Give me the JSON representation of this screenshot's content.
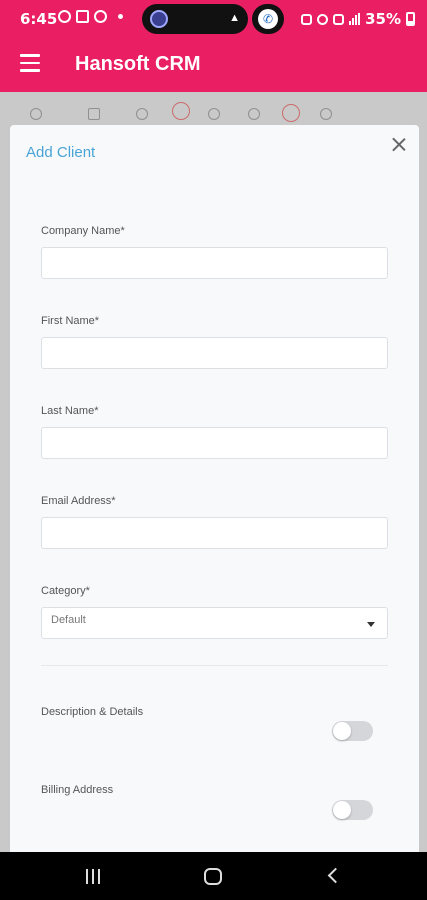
{
  "status_bar": {
    "time": "6:45",
    "battery": "35%",
    "icons": [
      "whatsapp-icon",
      "gallery-icon",
      "chrome-icon",
      "notification-dot-icon",
      "assistant-icon",
      "bell-icon",
      "call-icon",
      "vibrate-icon",
      "alarm-icon",
      "volte-icon",
      "signal-icon",
      "battery-icon"
    ]
  },
  "app_bar": {
    "title": "Hansoft CRM",
    "background": "#e91e63"
  },
  "modal": {
    "title": "Add Client",
    "title_color": "#4aa3d6",
    "fields": {
      "company_name": {
        "label": "Company Name*",
        "value": ""
      },
      "first_name": {
        "label": "First Name*",
        "value": ""
      },
      "last_name": {
        "label": "Last Name*",
        "value": ""
      },
      "email": {
        "label": "Email Address*",
        "value": ""
      },
      "category": {
        "label": "Category*",
        "value": "Default"
      }
    },
    "toggles": {
      "description": {
        "label": "Description & Details",
        "on": false
      },
      "billing": {
        "label": "Billing Address",
        "on": false
      }
    }
  }
}
